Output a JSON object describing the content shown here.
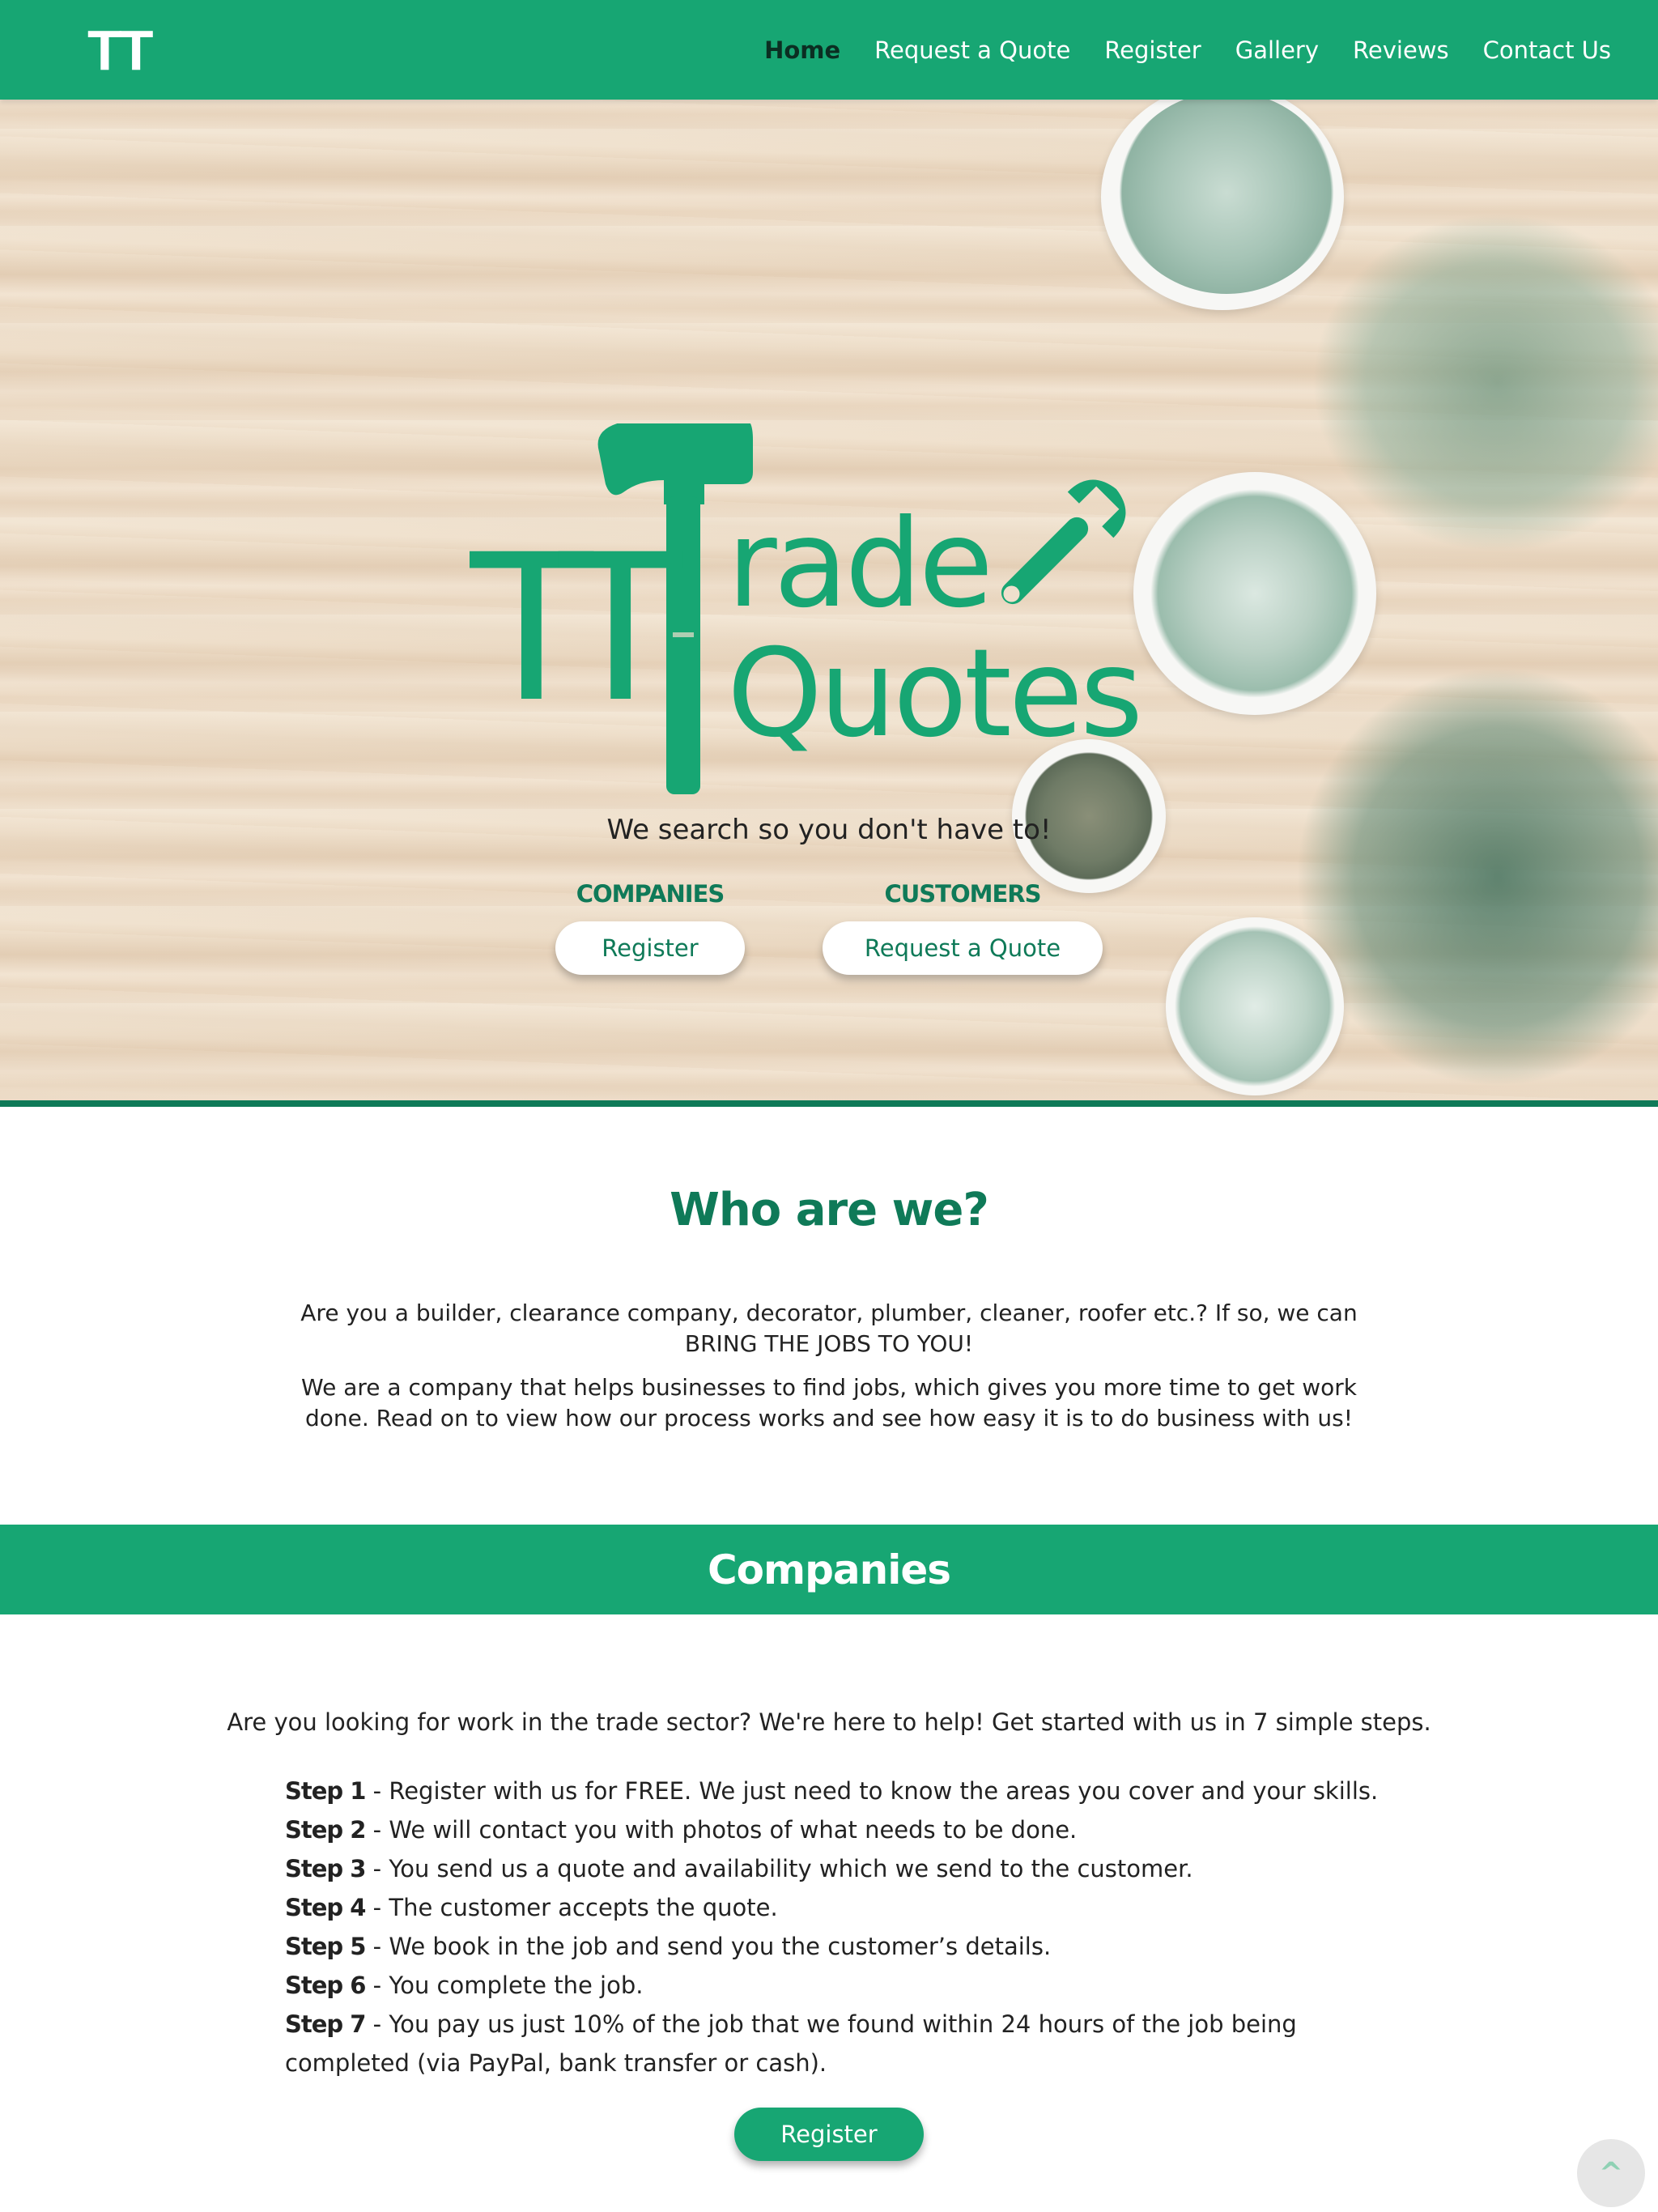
{
  "brand": {
    "logo_text": "TT"
  },
  "nav": {
    "items": [
      "Home",
      "Request a Quote",
      "Register",
      "Gallery",
      "Reviews",
      "Contact Us"
    ],
    "active": "Home"
  },
  "hero": {
    "logo": {
      "word_1": "TT",
      "word_2": "rade",
      "word_3": "Quotes"
    },
    "tagline": "We search so you don't have to!",
    "companies_label": "COMPANIES",
    "companies_button": "Register",
    "customers_label": "CUSTOMERS",
    "customers_button": "Request a Quote"
  },
  "who": {
    "title": "Who are we?",
    "paragraph_1": "Are you a builder, clearance company, decorator, plumber, cleaner, roofer etc.? If so, we can BRING THE JOBS TO YOU!",
    "paragraph_2": "We are a company that helps businesses to find jobs, which gives you more time to get work done. Read on to view how our process works and see how easy it is to do business with us!"
  },
  "companies": {
    "title": "Companies",
    "intro": "Are you looking for work in the trade sector? We're here to help! Get started with us in 7 simple steps.",
    "steps": [
      {
        "label": "Step 1",
        "text": " - Register with us for FREE. We just need to know the areas you cover and your skills."
      },
      {
        "label": "Step 2",
        "text": " - We will contact you with photos of what needs to be done."
      },
      {
        "label": "Step 3",
        "text": " - You send us a quote and availability which we send to the customer."
      },
      {
        "label": "Step 4",
        "text": " - The customer accepts the quote."
      },
      {
        "label": "Step 5",
        "text": " - We book in the job and send you the customer’s details."
      },
      {
        "label": "Step 6",
        "text": " - You complete the job."
      },
      {
        "label": "Step 7",
        "text": " - You pay us just 10% of the job that we found within 24 hours of the job being completed (via PayPal, bank transfer or cash)."
      }
    ],
    "register_button": "Register"
  },
  "back_to_top": "^",
  "colors": {
    "primary": "#17a673",
    "dark_green": "#0f7a58"
  },
  "icons": [
    "hammer-icon",
    "wrench-icon"
  ]
}
